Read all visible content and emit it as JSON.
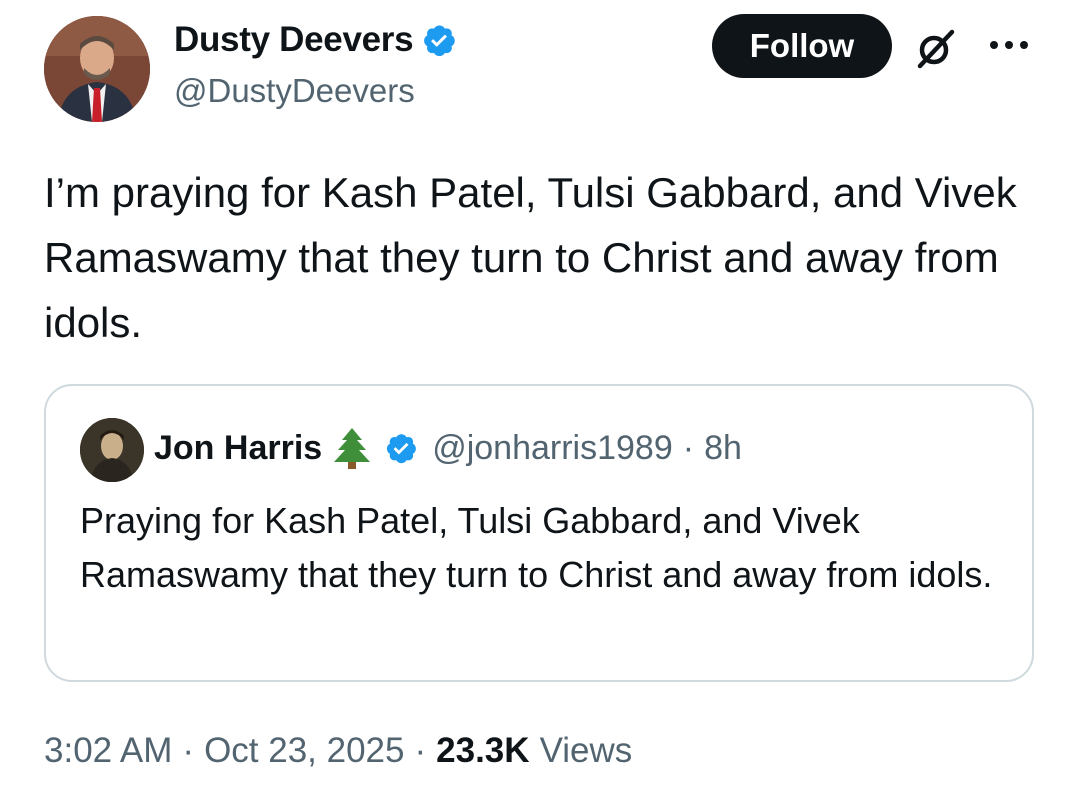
{
  "author": {
    "name": "Dusty Deevers",
    "handle": "@DustyDeevers",
    "verified": true
  },
  "actions": {
    "follow_label": "Follow",
    "grok_icon": "grok-icon",
    "more_icon": "more-options-icon"
  },
  "tweet": {
    "text": "I’m praying for Kash Patel, Tulsi Gabbard, and Vivek Ramaswamy that they turn to Christ and away from idols."
  },
  "quote": {
    "name": "Jon Harris",
    "emoji_icon": "christmas-tree-icon",
    "verified": true,
    "handle": "@jonharris1989",
    "separator": "·",
    "time": "8h",
    "text": "Praying for Kash Patel, Tulsi Gabbard, and Vivek Ramaswamy that they turn to Christ and away from idols."
  },
  "meta": {
    "time": "3:02 AM",
    "separator1": "·",
    "date": "Oct 23, 2025",
    "separator2": "·",
    "views_count": "23.3K",
    "views_label": "Views"
  },
  "colors": {
    "verified_blue": "#1d9bf0",
    "text_primary": "#0f1419",
    "text_secondary": "#536471",
    "border": "#cfd9de",
    "follow_bg": "#0f1419"
  }
}
